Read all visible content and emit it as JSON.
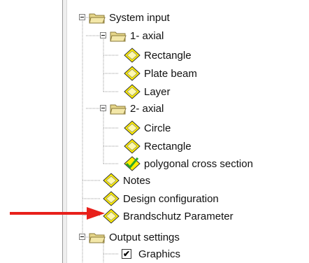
{
  "tree": {
    "system_input": "System input",
    "axial1": {
      "label": "1- axial",
      "items": [
        "Rectangle",
        "Plate beam",
        "Layer"
      ]
    },
    "axial2": {
      "label": "2- axial",
      "items": [
        "Circle",
        "Rectangle",
        "polygonal cross section"
      ]
    },
    "notes": "Notes",
    "design_configuration": "Design  configuration",
    "brandschutz": "Brandschutz Parameter",
    "output_settings": "Output settings",
    "graphics": "Graphics",
    "graphics_checked": true,
    "graphics_check_glyph": "✔"
  },
  "colors": {
    "arrow": "#e8201b",
    "diamond": "#ffee00",
    "folder": "#e6d68a",
    "check_green": "#2ba52b"
  }
}
